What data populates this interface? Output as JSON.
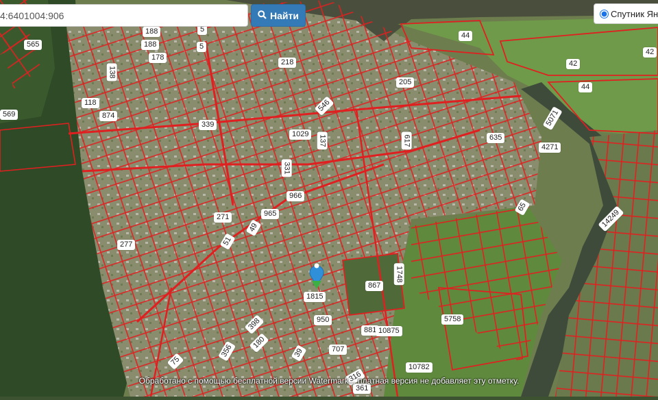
{
  "search": {
    "value": "4:6401004:906",
    "button_label": "Найти",
    "button_icon": "search-icon"
  },
  "layer": {
    "label": "Спутник Ян",
    "selected": true
  },
  "watermark": "Обработано с помощью бесплатной версии Watermark... платная версия не добавляет эту отметку.",
  "colors": {
    "parcel_border": "#e02020",
    "button": "#337ab7",
    "marker_blue": "#2f8fd8",
    "marker_green": "#3cb043"
  },
  "parcel_labels": [
    "565",
    "188",
    "188",
    "5",
    "178",
    "5",
    "569",
    "218",
    "138",
    "205",
    "118",
    "874",
    "546",
    "5071",
    "339",
    "1029",
    "137",
    "617",
    "635",
    "4271",
    "331",
    "966",
    "965",
    "271",
    "49",
    "51",
    "277",
    "1748",
    "867",
    "1815",
    "14249",
    "950",
    "881",
    "10875",
    "5758",
    "398",
    "180",
    "707",
    "75",
    "356",
    "39",
    "10782",
    "316",
    "361",
    "44",
    "42",
    "42",
    "44",
    "65"
  ]
}
